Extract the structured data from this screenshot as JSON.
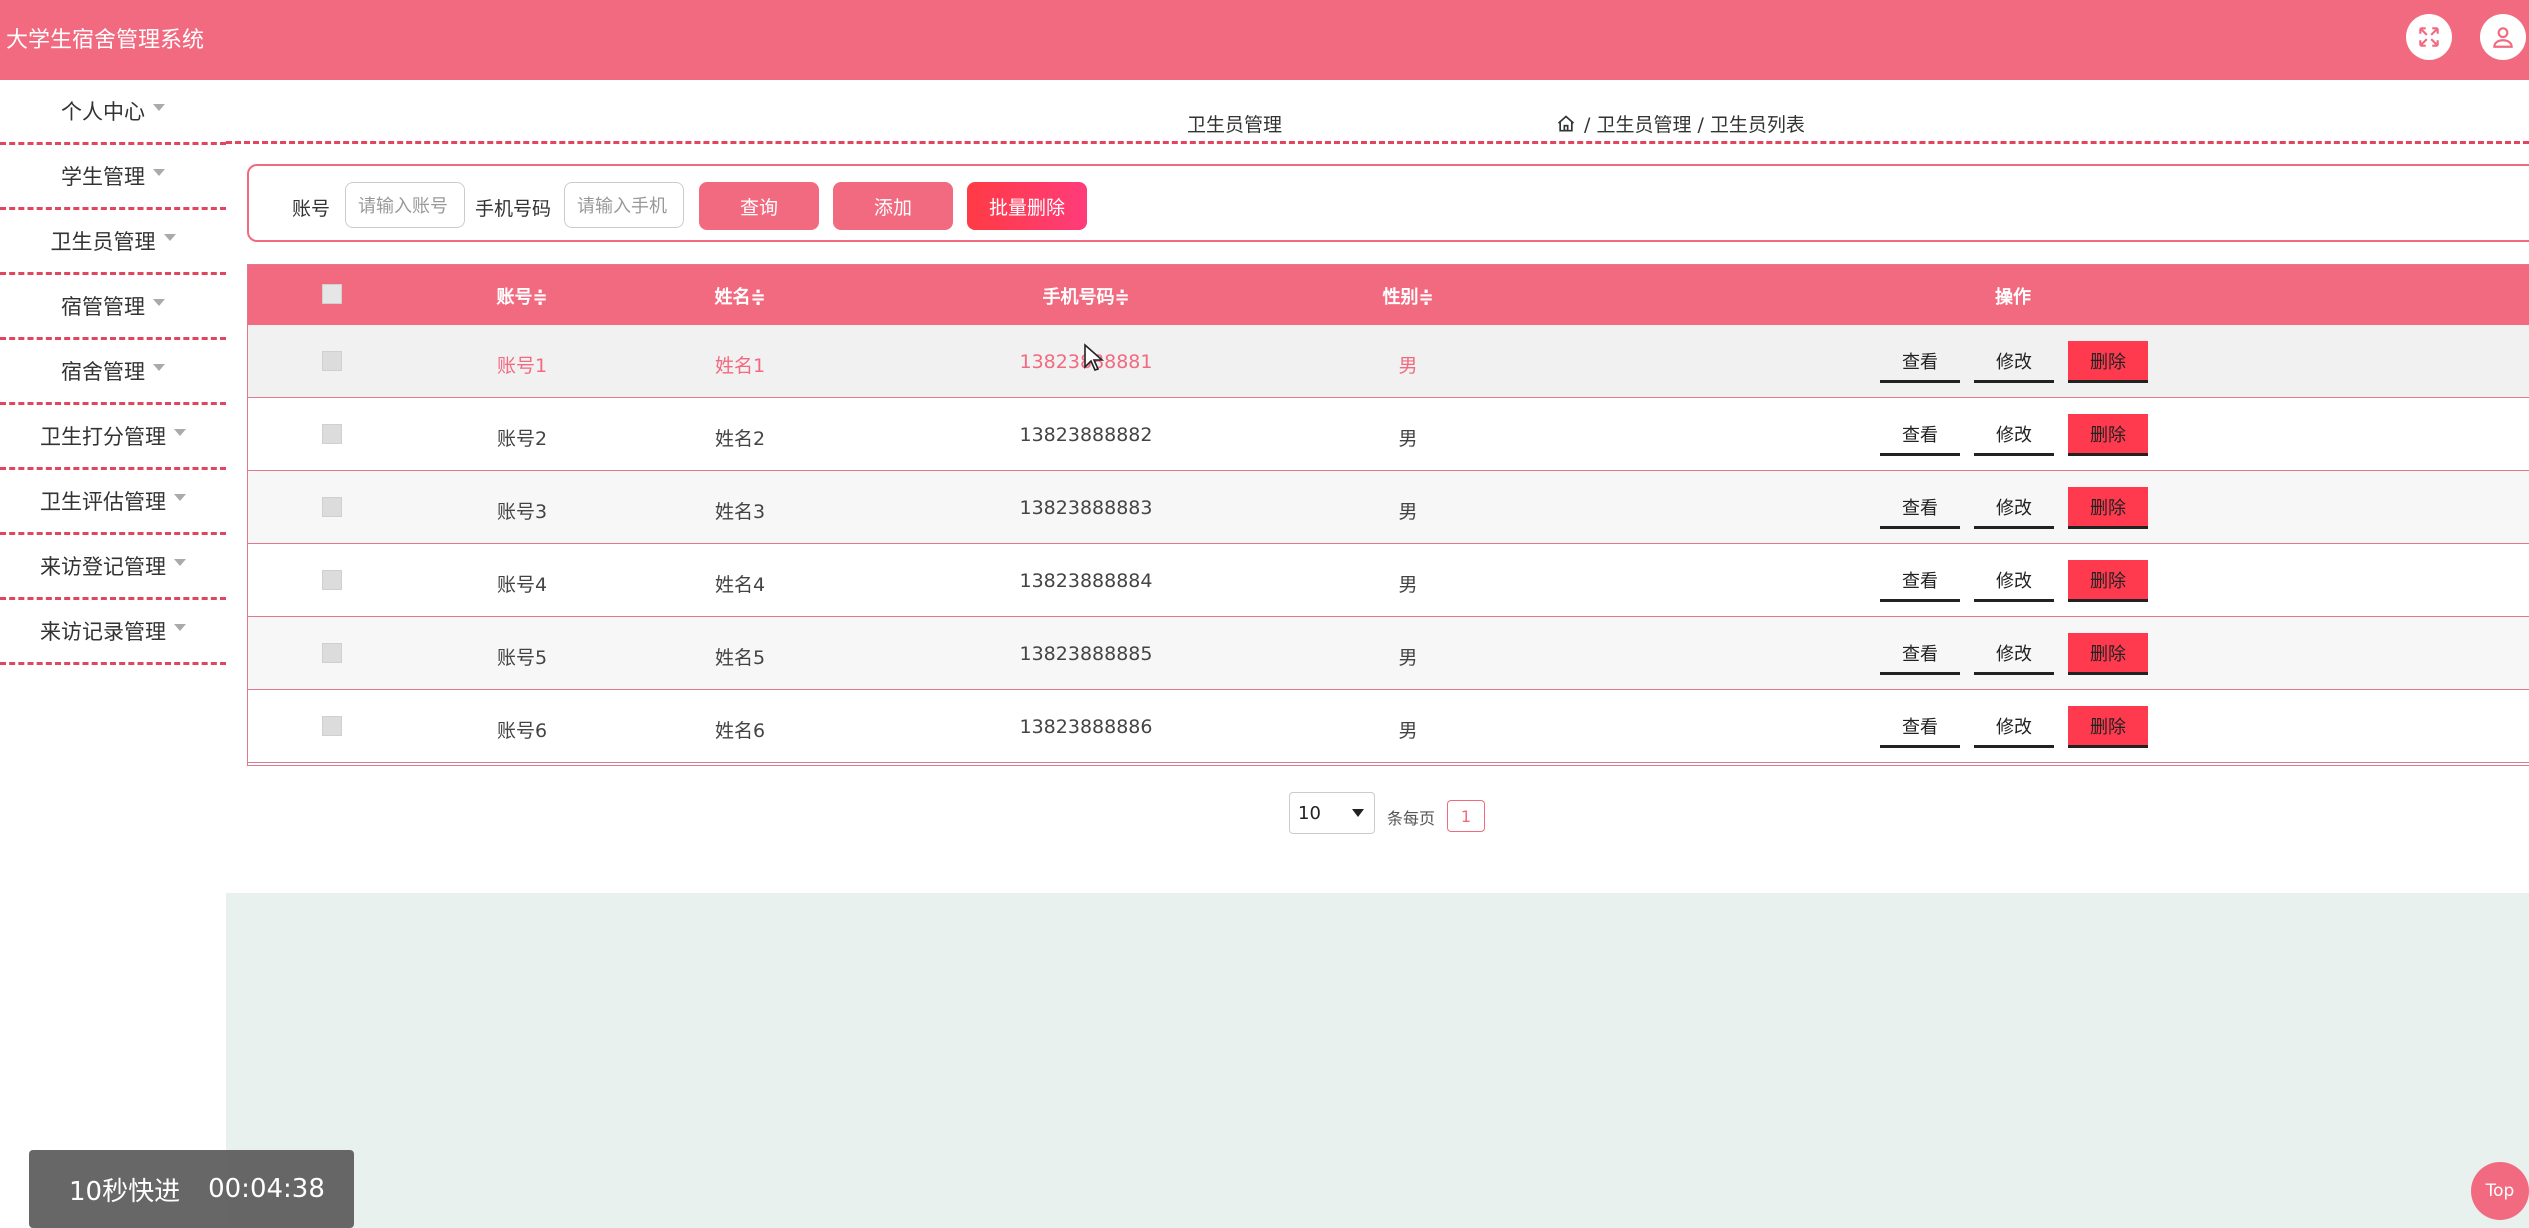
{
  "header": {
    "app_title": "大学生宿舍管理系统",
    "fullscreen_icon": "fullscreen-icon",
    "user_icon": "user-icon"
  },
  "sidebar": {
    "items": [
      {
        "label": "个人中心"
      },
      {
        "label": "学生管理"
      },
      {
        "label": "卫生员管理"
      },
      {
        "label": "宿管管理"
      },
      {
        "label": "宿舍管理"
      },
      {
        "label": "卫生打分管理"
      },
      {
        "label": "卫生评估管理"
      },
      {
        "label": "来访登记管理"
      },
      {
        "label": "来访记录管理"
      }
    ]
  },
  "breadcrumb": {
    "title": "卫生员管理",
    "home_icon": "home-icon",
    "path": "/ 卫生员管理 / 卫生员列表"
  },
  "search": {
    "account_label": "账号",
    "account_placeholder": "请输入账号",
    "phone_label": "手机号码",
    "phone_placeholder": "请输入手机",
    "query_button": "查询",
    "add_button": "添加",
    "batch_delete_button": "批量删除"
  },
  "table": {
    "columns": [
      "账号≑",
      "姓名≑",
      "手机号码≑",
      "性别≑",
      "操作"
    ],
    "rows": [
      {
        "account": "账号1",
        "name": "姓名1",
        "phone": "13823888881",
        "gender": "男"
      },
      {
        "account": "账号2",
        "name": "姓名2",
        "phone": "13823888882",
        "gender": "男"
      },
      {
        "account": "账号3",
        "name": "姓名3",
        "phone": "13823888883",
        "gender": "男"
      },
      {
        "account": "账号4",
        "name": "姓名4",
        "phone": "13823888884",
        "gender": "男"
      },
      {
        "account": "账号5",
        "name": "姓名5",
        "phone": "13823888885",
        "gender": "男"
      },
      {
        "account": "账号6",
        "name": "姓名6",
        "phone": "13823888886",
        "gender": "男"
      }
    ],
    "actions": {
      "view": "查看",
      "edit": "修改",
      "delete": "删除"
    }
  },
  "pagination": {
    "page_size": "10",
    "per_page_label": "条每页",
    "current_page": "1"
  },
  "overlay": {
    "label": "10秒快进",
    "time": "00:04:38"
  },
  "top_button": "Top",
  "colors": {
    "primary": "#f26a80",
    "danger": "#ff3a4e",
    "footer_bg": "#e8f1ee"
  }
}
